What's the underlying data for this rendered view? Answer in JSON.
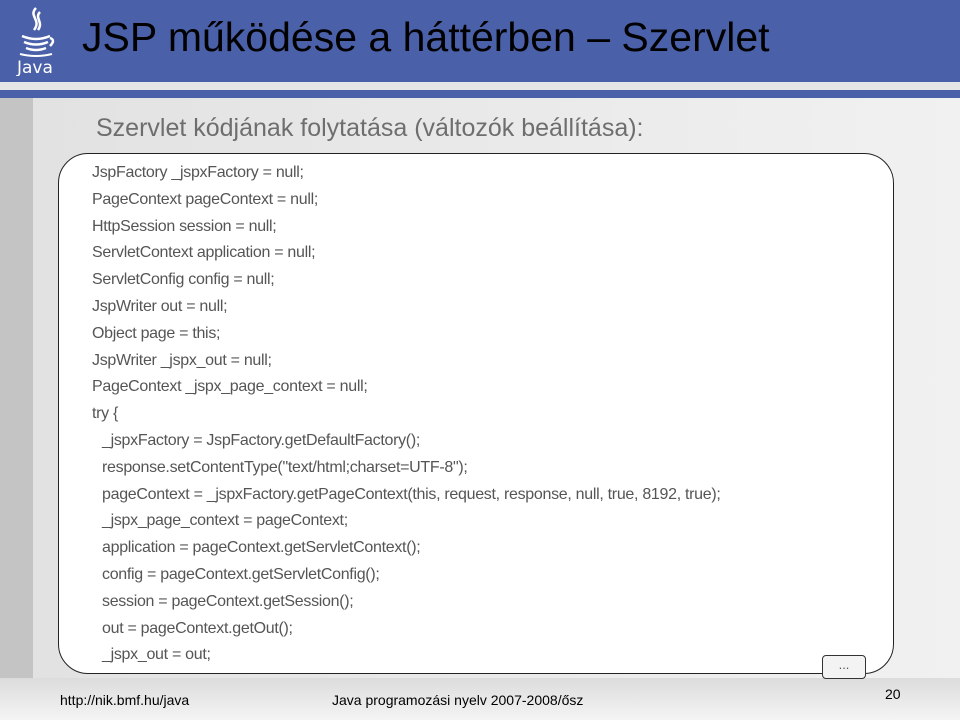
{
  "header": {
    "title": "JSP működése a háttérben – Szervlet",
    "logo_text": "Java"
  },
  "subtitle": "Szervlet kódjának folytatása (változók beállítása):",
  "code_lines": [
    {
      "text": "JspFactory _jspxFactory = null;",
      "indent": false
    },
    {
      "text": "PageContext pageContext = null;",
      "indent": false
    },
    {
      "text": "HttpSession session = null;",
      "indent": false
    },
    {
      "text": "ServletContext application = null;",
      "indent": false
    },
    {
      "text": "ServletConfig config = null;",
      "indent": false
    },
    {
      "text": "JspWriter out = null;",
      "indent": false
    },
    {
      "text": "Object page = this;",
      "indent": false
    },
    {
      "text": "JspWriter _jspx_out = null;",
      "indent": false
    },
    {
      "text": "PageContext _jspx_page_context = null;",
      "indent": false
    },
    {
      "text": "try {",
      "indent": false
    },
    {
      "text": "_jspxFactory = JspFactory.getDefaultFactory();",
      "indent": true
    },
    {
      "text": "response.setContentType(\"text/html;charset=UTF-8\");",
      "indent": true
    },
    {
      "text": "pageContext = _jspxFactory.getPageContext(this, request, response, null, true, 8192, true);",
      "indent": true
    },
    {
      "text": "_jspx_page_context = pageContext;",
      "indent": true
    },
    {
      "text": "application = pageContext.getServletContext();",
      "indent": true
    },
    {
      "text": "config = pageContext.getServletConfig();",
      "indent": true
    },
    {
      "text": "session = pageContext.getSession();",
      "indent": true
    },
    {
      "text": "out = pageContext.getOut();",
      "indent": true
    },
    {
      "text": "_jspx_out = out;",
      "indent": true
    }
  ],
  "more_label": "...",
  "footer": {
    "url": "http://nik.bmf.hu/java",
    "course": "Java programozási nyelv 2007-2008/ősz",
    "page_number": "20"
  },
  "colors": {
    "header_blue": "#4a60a9",
    "subtitle_gray": "#6e6e6e"
  },
  "icons": {
    "logo": "java-coffee-cup-logo"
  }
}
